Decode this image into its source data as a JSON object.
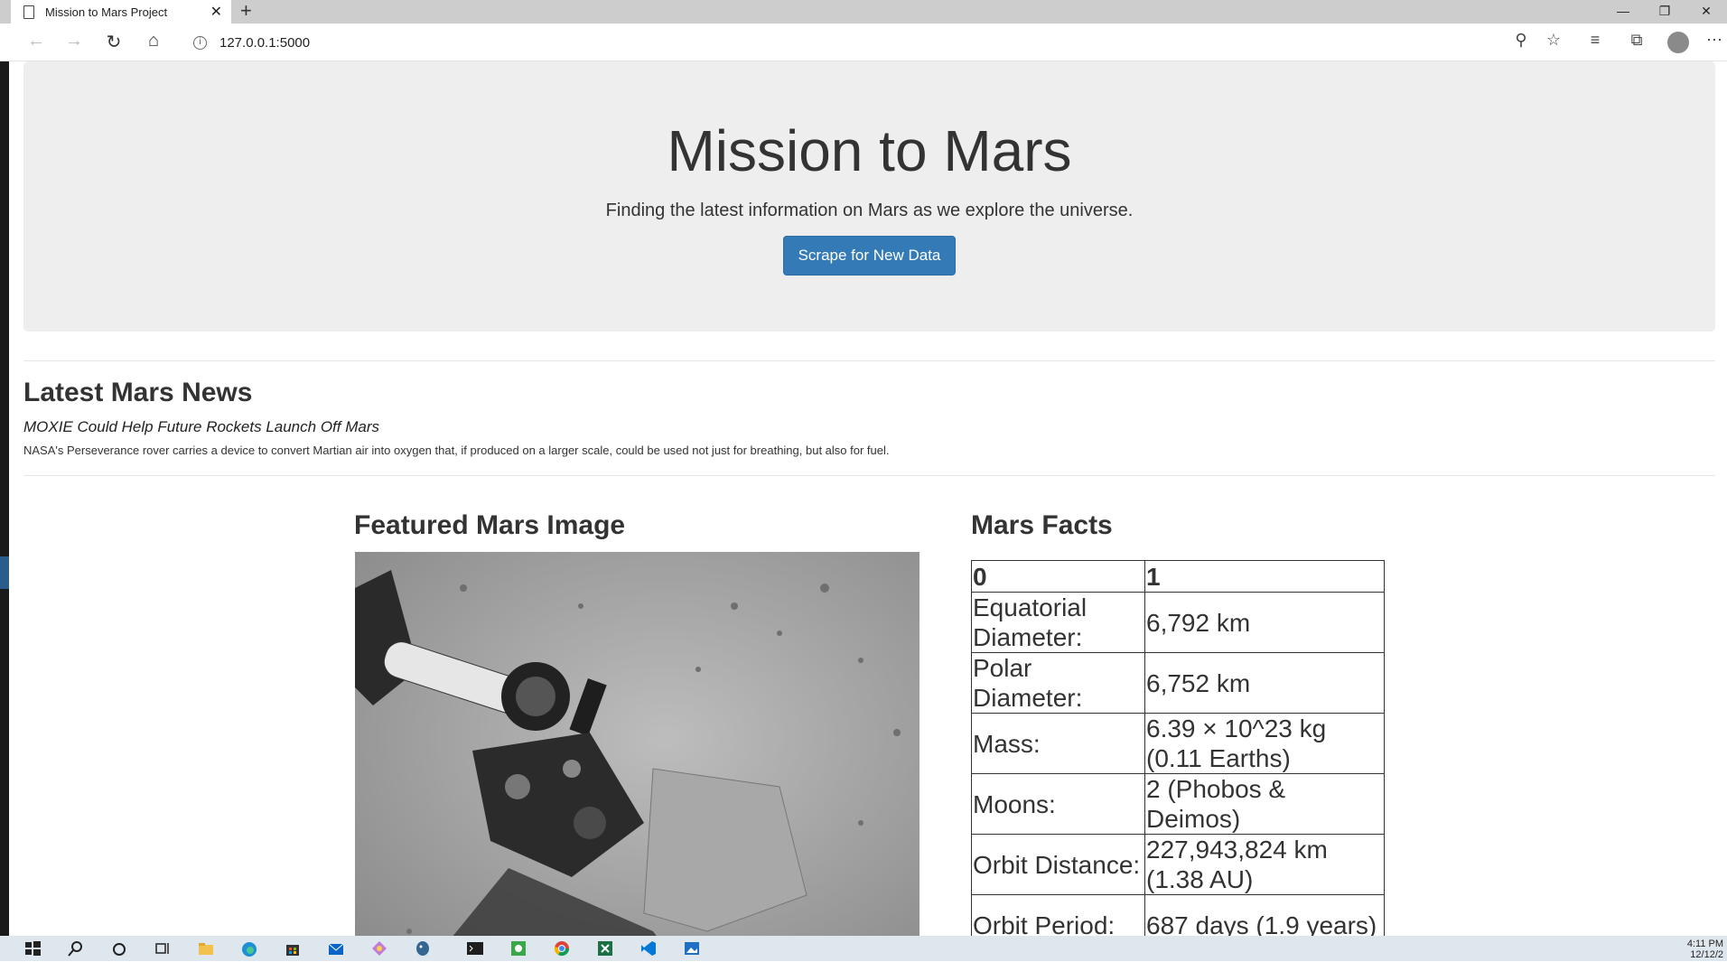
{
  "browser": {
    "tab_title": "Mission to Mars Project",
    "new_tab_symbol": "+",
    "close_symbol": "✕",
    "address": "127.0.0.1:5000",
    "window_controls": [
      "—",
      "❐",
      "✕"
    ]
  },
  "jumbotron": {
    "title": "Mission to Mars",
    "subtitle": "Finding the latest information on Mars as we explore the universe.",
    "button_label": "Scrape for New Data"
  },
  "news": {
    "heading": "Latest Mars News",
    "title": "MOXIE Could Help Future Rockets Launch Off Mars",
    "paragraph": "NASA's Perseverance rover carries a device to convert Martian air into oxygen that, if produced on a larger scale, could be used not just for breathing, but also for fuel."
  },
  "featured_image": {
    "heading": "Featured Mars Image"
  },
  "facts": {
    "heading": "Mars Facts",
    "columns": [
      "0",
      "1"
    ],
    "rows": [
      [
        "Equatorial Diameter:",
        "6,792 km"
      ],
      [
        "Polar Diameter:",
        "6,752 km"
      ],
      [
        "Mass:",
        "6.39 × 10^23 kg (0.11 Earths)"
      ],
      [
        "Moons:",
        "2 (Phobos & Deimos)"
      ],
      [
        "Orbit Distance:",
        "227,943,824 km (1.38 AU)"
      ],
      [
        "Orbit Period:",
        "687 days (1.9 years)"
      ]
    ]
  },
  "taskbar": {
    "clock_time": "4:11 PM",
    "clock_date": "12/12/2"
  },
  "colors": {
    "primary_button": "#337ab7",
    "jumbotron_bg": "#eeeeee",
    "taskbar_bg": "#dfe7ee"
  }
}
